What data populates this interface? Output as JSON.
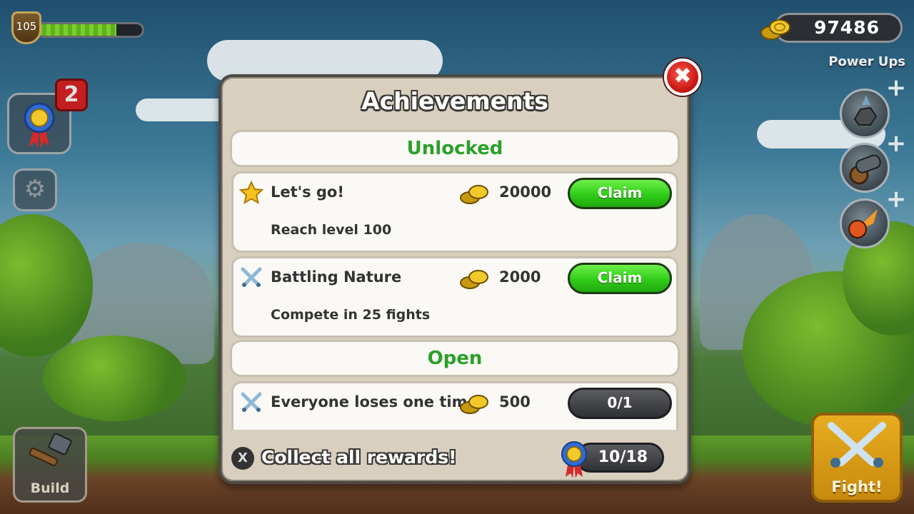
{
  "hud": {
    "player_level": "105",
    "xp_progress": 0.75,
    "coins": "97486",
    "power_ups_label": "Power Ups",
    "achievement_badge_count": "2",
    "build_label": "Build",
    "fight_label": "Fight!"
  },
  "modal": {
    "title": "Achievements",
    "sections": {
      "unlocked": "Unlocked",
      "open": "Open"
    },
    "unlocked": [
      {
        "icon": "star-icon",
        "title": "Let's go!",
        "reward": "20000",
        "description": "Reach level 100",
        "action": "Claim"
      },
      {
        "icon": "crossed-swords-icon",
        "title": "Battling Nature",
        "reward": "2000",
        "description": "Compete in 25 fights",
        "action": "Claim"
      }
    ],
    "open": [
      {
        "icon": "crossed-swords-icon",
        "title": "Everyone loses one time",
        "reward": "500",
        "progress": "0/1"
      }
    ],
    "footer": {
      "button_glyph": "X",
      "text": "Collect all rewards!",
      "total_progress": "10/18"
    }
  },
  "colors": {
    "section_heading": "#2aa12a",
    "claim_button": "#2fcc18",
    "close_button": "#d81e17",
    "fight_button": "#e0a01a"
  }
}
